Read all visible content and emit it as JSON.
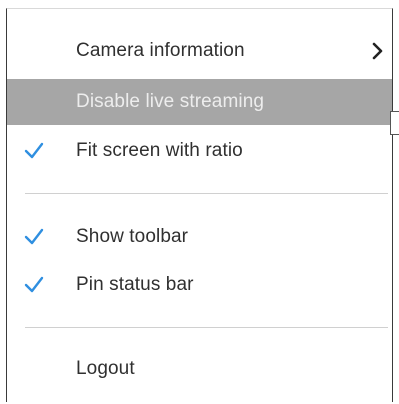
{
  "menu": {
    "items": [
      {
        "label": "Camera information",
        "checked": false,
        "submenu": true,
        "highlighted": false
      },
      {
        "label": "Disable live streaming",
        "checked": false,
        "submenu": false,
        "highlighted": true
      },
      {
        "label": "Fit screen with ratio",
        "checked": true,
        "submenu": false,
        "highlighted": false
      },
      {
        "label": "Show toolbar",
        "checked": true,
        "submenu": false,
        "highlighted": false
      },
      {
        "label": "Pin status bar",
        "checked": true,
        "submenu": false,
        "highlighted": false
      },
      {
        "label": "Logout",
        "checked": false,
        "submenu": false,
        "highlighted": false
      }
    ]
  },
  "colors": {
    "check": "#2f8fe0",
    "highlight_bg": "#a6a6a6",
    "text": "#303030"
  },
  "icons": {
    "check": "checkmark-icon",
    "submenu": "chevron-right-icon"
  }
}
